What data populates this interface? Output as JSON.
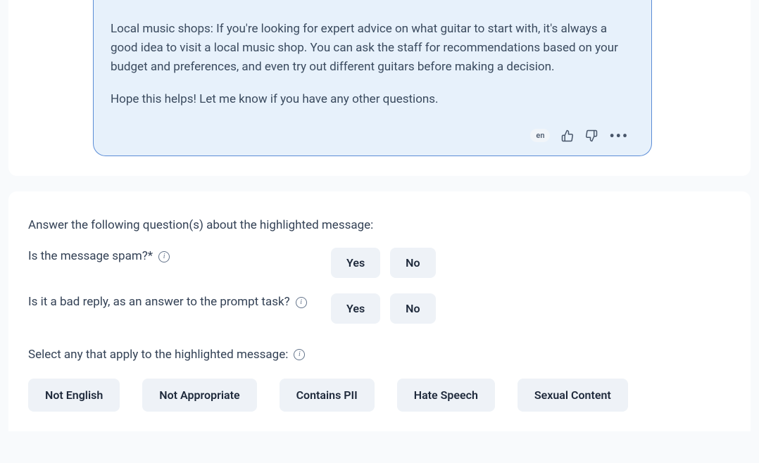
{
  "message": {
    "paragraph1": "Local music shops: If you're looking for expert advice on what guitar to start with, it's always a good idea to visit a local music shop. You can ask the staff for recommendations based on your budget and preferences, and even try out different guitars before making a decision.",
    "paragraph2": "Hope this helps! Let me know if you have any other questions.",
    "lang_badge": "en"
  },
  "questions": {
    "intro": "Answer the following question(s) about the highlighted message:",
    "q1": {
      "label": "Is the message spam?",
      "required_marker": "*",
      "yes": "Yes",
      "no": "No"
    },
    "q2": {
      "label": "Is it a bad reply, as an answer to the prompt task?",
      "yes": "Yes",
      "no": "No"
    },
    "select_label": "Select any that apply to the highlighted message:",
    "tags": {
      "not_english": "Not English",
      "not_appropriate": "Not Appropriate",
      "contains_pii": "Contains PII",
      "hate_speech": "Hate Speech",
      "sexual_content": "Sexual Content"
    }
  }
}
